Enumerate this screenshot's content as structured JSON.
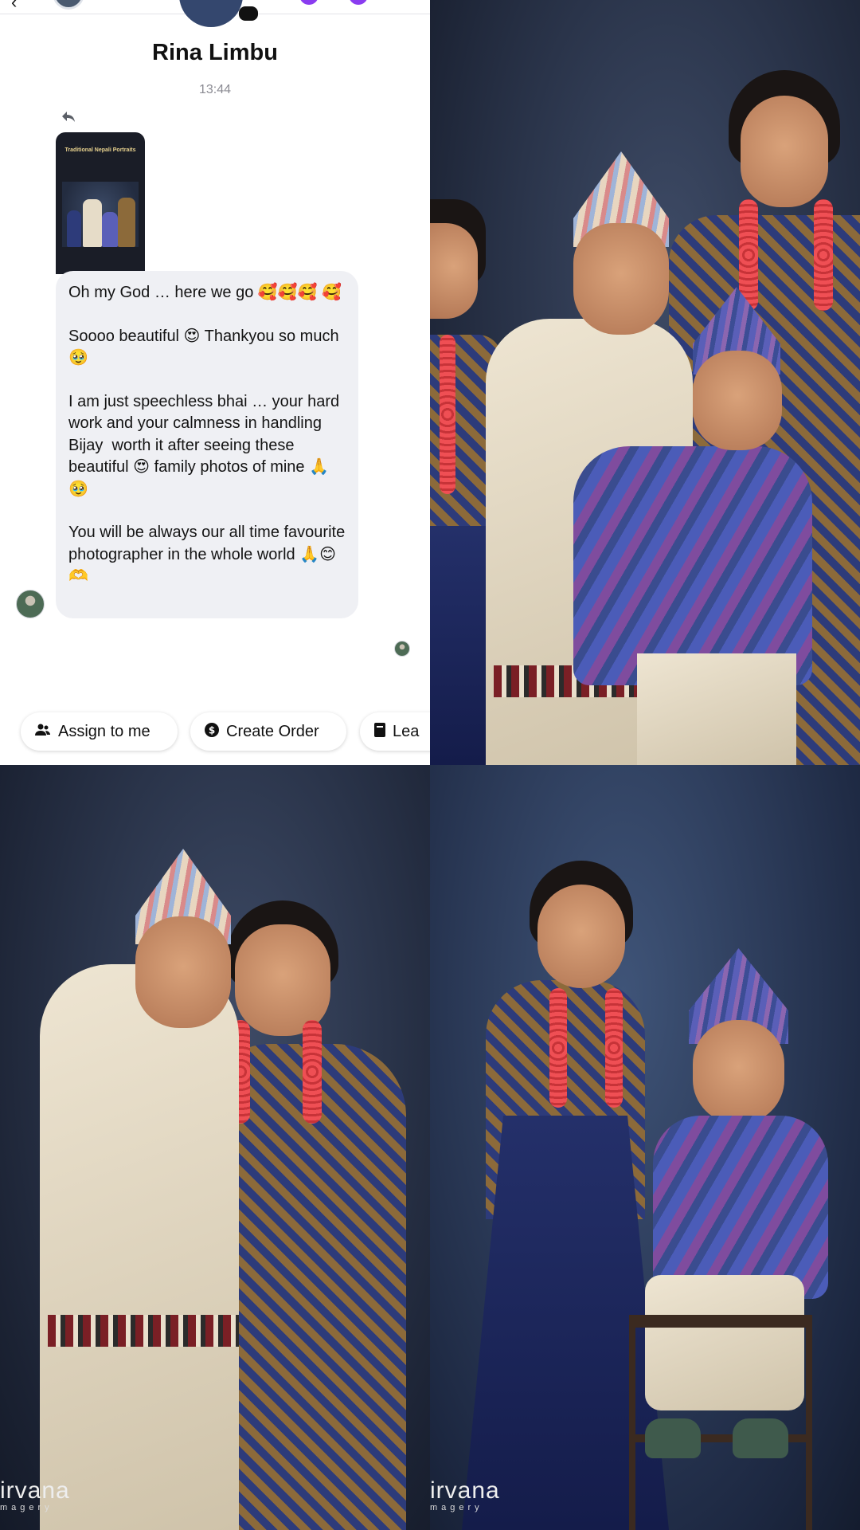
{
  "chat": {
    "contact_name": "Rina Limbu",
    "timestamp": "13:44",
    "story_title": "Traditional Nepali Portraits",
    "message_paragraphs": [
      "Oh my God … here we go 🥰🥰🥰 🥰",
      "Soooo beautiful 😍 Thankyou so much 🥹",
      "I am just speechless bhai … your hard work and your calmness in handling Bijay  worth it after seeing these beautiful 😍 family photos of mine 🙏🥹",
      "You will be always our all time favourite photographer in the whole world 🙏😊🫶"
    ],
    "actions": [
      {
        "label": "Assign to me",
        "icon": "assign-user-icon"
      },
      {
        "label": "Create Order",
        "icon": "dollar-icon"
      },
      {
        "label": "Lea",
        "icon": "lead-icon"
      }
    ]
  },
  "photos": {
    "watermark_text": "irvana",
    "watermark_sub": "magery"
  },
  "colors": {
    "bubble_bg": "#eff0f4",
    "chat_bg": "#ffffff",
    "accent_purple": "#8a3cf0",
    "backdrop_dark": "#1b2233"
  }
}
